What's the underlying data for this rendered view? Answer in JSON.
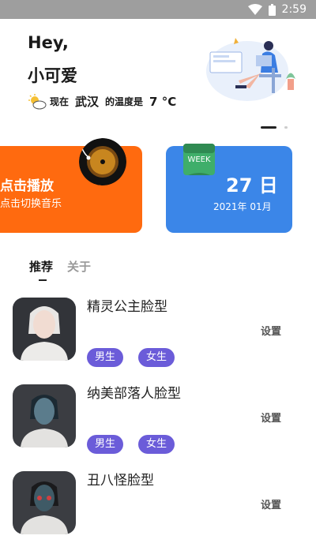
{
  "status_bar": {
    "time": "2:59"
  },
  "header": {
    "greeting": "Hey,",
    "name": "小可爱",
    "weather_prefix": "现在",
    "city": "武汉",
    "weather_mid": "的温度是",
    "temperature": "7 °C",
    "weather_icon": "partly-cloudy-icon"
  },
  "banner": {
    "music_card": {
      "title": "点击播放",
      "subtitle": "点击切换音乐",
      "color": "#ff6a0f"
    },
    "date_card": {
      "day": "27 日",
      "year_month": "2021年 01月",
      "badge": "WEEK",
      "color": "#3b86e8"
    },
    "pager": {
      "pages": 2,
      "active": 1
    }
  },
  "tabs": [
    {
      "label": "推荐",
      "active": true
    },
    {
      "label": "关于",
      "active": false
    }
  ],
  "list": {
    "action_label": "设置",
    "tag_color": "#6b5cd9",
    "items": [
      {
        "name": "精灵公主脸型",
        "tags": [
          "男生",
          "女生"
        ]
      },
      {
        "name": "纳美部落人脸型",
        "tags": [
          "男生",
          "女生"
        ]
      },
      {
        "name": "丑八怪脸型",
        "tags": []
      }
    ]
  }
}
